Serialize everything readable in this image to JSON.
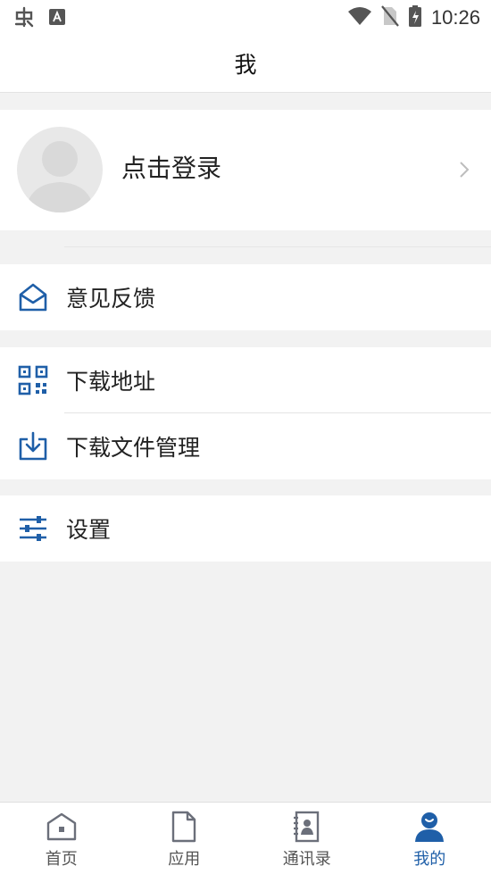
{
  "status_bar": {
    "time": "10:26"
  },
  "header": {
    "title": "我"
  },
  "profile": {
    "login_label": "点击登录"
  },
  "menu": {
    "feedback": "意见反馈",
    "download_address": "下载地址",
    "download_manager": "下载文件管理",
    "settings": "设置"
  },
  "tabs": [
    {
      "label": "首页",
      "icon": "home-icon",
      "active": false
    },
    {
      "label": "应用",
      "icon": "document-icon",
      "active": false
    },
    {
      "label": "通讯录",
      "icon": "contacts-icon",
      "active": false
    },
    {
      "label": "我的",
      "icon": "profile-icon",
      "active": true
    }
  ],
  "colors": {
    "accent": "#1f5fa8",
    "background": "#f2f2f2",
    "inactive_icon": "#6b6f7a"
  }
}
